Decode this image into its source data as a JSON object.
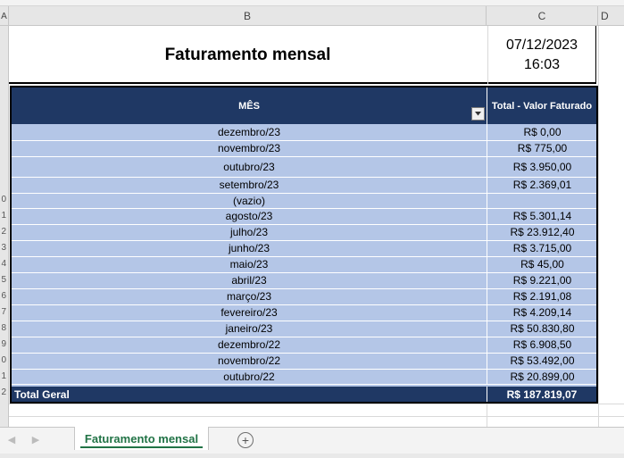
{
  "columns": {
    "a": "A",
    "b": "B",
    "c": "C",
    "d": "D"
  },
  "row_numbers": [
    "0",
    "1",
    "2",
    "3",
    "4",
    "5",
    "6",
    "7",
    "8",
    "9",
    "0",
    "1",
    "2"
  ],
  "title": "Faturamento mensal",
  "date": "07/12/2023",
  "time": "16:03",
  "table": {
    "header_month": "MÊS",
    "header_total": "Total - Valor Faturado",
    "rows": [
      {
        "month": "dezembro/23",
        "value": "R$ 0,00"
      },
      {
        "month": "novembro/23",
        "value": "R$ 775,00"
      },
      {
        "month": "outubro/23",
        "value": "R$ 3.950,00"
      },
      {
        "month": "setembro/23",
        "value": "R$ 2.369,01"
      },
      {
        "month": "(vazio)",
        "value": ""
      },
      {
        "month": "agosto/23",
        "value": "R$ 5.301,14"
      },
      {
        "month": "julho/23",
        "value": "R$ 23.912,40"
      },
      {
        "month": "junho/23",
        "value": "R$ 3.715,00"
      },
      {
        "month": "maio/23",
        "value": "R$ 45,00"
      },
      {
        "month": "abril/23",
        "value": "R$ 9.221,00"
      },
      {
        "month": "março/23",
        "value": "R$ 2.191,08"
      },
      {
        "month": "fevereiro/23",
        "value": "R$ 4.209,14"
      },
      {
        "month": "janeiro/23",
        "value": "R$ 50.830,80"
      },
      {
        "month": "dezembro/22",
        "value": "R$ 6.908,50"
      },
      {
        "month": "novembro/22",
        "value": "R$ 53.492,00"
      },
      {
        "month": "outubro/22",
        "value": "R$ 20.899,00"
      }
    ],
    "total_label": "Total Geral",
    "total_value": "R$ 187.819,07"
  },
  "sheet_tab": "Faturamento mensal",
  "add_sheet_icon": "+",
  "nav_prev_icon": "◀",
  "nav_next_icon": "▶",
  "filter_icon": "filter-dropdown-icon",
  "colors": {
    "header_bg": "#1f3864",
    "row_bg": "#b4c6e7",
    "tab_green": "#217346"
  }
}
